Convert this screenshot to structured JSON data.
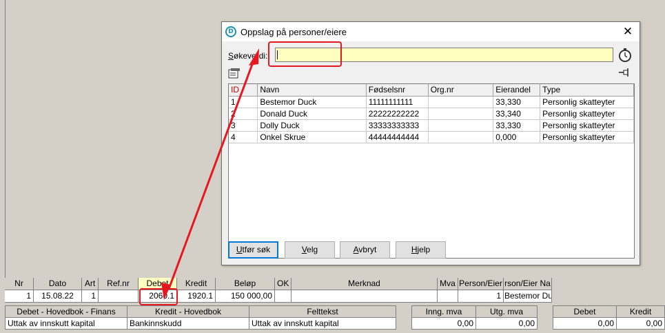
{
  "dialog": {
    "title": "Oppslag på personer/eiere",
    "close_glyph": "✕",
    "search_label_underlined": "S",
    "search_label_rest": "økeverdi:",
    "search_value": "",
    "columns": [
      "ID",
      "Navn",
      "Fødselsnr",
      "Org.nr",
      "Eierandel",
      "Type"
    ],
    "rows": [
      {
        "id": "1",
        "navn": "Bestemor Duck",
        "fodselsnr": "11111111111",
        "orgnr": "",
        "eierandel": "33,330",
        "type": "Personlig skatteyter"
      },
      {
        "id": "2",
        "navn": "Donald Duck",
        "fodselsnr": "22222222222",
        "orgnr": "",
        "eierandel": "33,340",
        "type": "Personlig skatteyter"
      },
      {
        "id": "3",
        "navn": "Dolly Duck",
        "fodselsnr": "33333333333",
        "orgnr": "",
        "eierandel": "33,330",
        "type": "Personlig skatteyter"
      },
      {
        "id": "4",
        "navn": "Onkel Skrue",
        "fodselsnr": "44444444444",
        "orgnr": "",
        "eierandel": "0,000",
        "type": "Personlig skatteyter"
      }
    ],
    "buttons": {
      "search": {
        "u": "U",
        "rest": "tfør søk"
      },
      "select": {
        "u": "V",
        "rest": "elg"
      },
      "cancel": {
        "u": "A",
        "rest": "vbryt"
      },
      "help": {
        "u": "H",
        "rest": "jelp"
      }
    }
  },
  "journal": {
    "headers": [
      "Nr",
      "Dato",
      "Art",
      "Ref.nr",
      "Debet",
      "Kredit",
      "Beløp",
      "OK",
      "Merknad",
      "Mva",
      "Person/Eier",
      "rson/Eier Na"
    ],
    "row": [
      "1",
      "15.08.22",
      "1",
      "",
      "2060.1",
      "1920.1",
      "150 000,00",
      "",
      "",
      "",
      "1",
      "Bestemor Du"
    ]
  },
  "accounts": {
    "headers": [
      "Debet - Hovedbok - Finans",
      "Kredit - Hovedbok",
      "Felttekst"
    ],
    "values": [
      "Uttak av innskutt kapital",
      "Bankinnskudd",
      "Uttak av innskutt kapital"
    ]
  },
  "mva": {
    "headers": [
      "Inng. mva",
      "Utg. mva"
    ],
    "values": [
      "0,00",
      "0,00"
    ]
  },
  "totals": {
    "headers": [
      "Debet",
      "Kredit"
    ],
    "values": [
      "0,00",
      "0,00"
    ]
  },
  "colors": {
    "highlight": "#e8161e",
    "search_bg": "#ffffc0",
    "id_header": "#d00000"
  }
}
